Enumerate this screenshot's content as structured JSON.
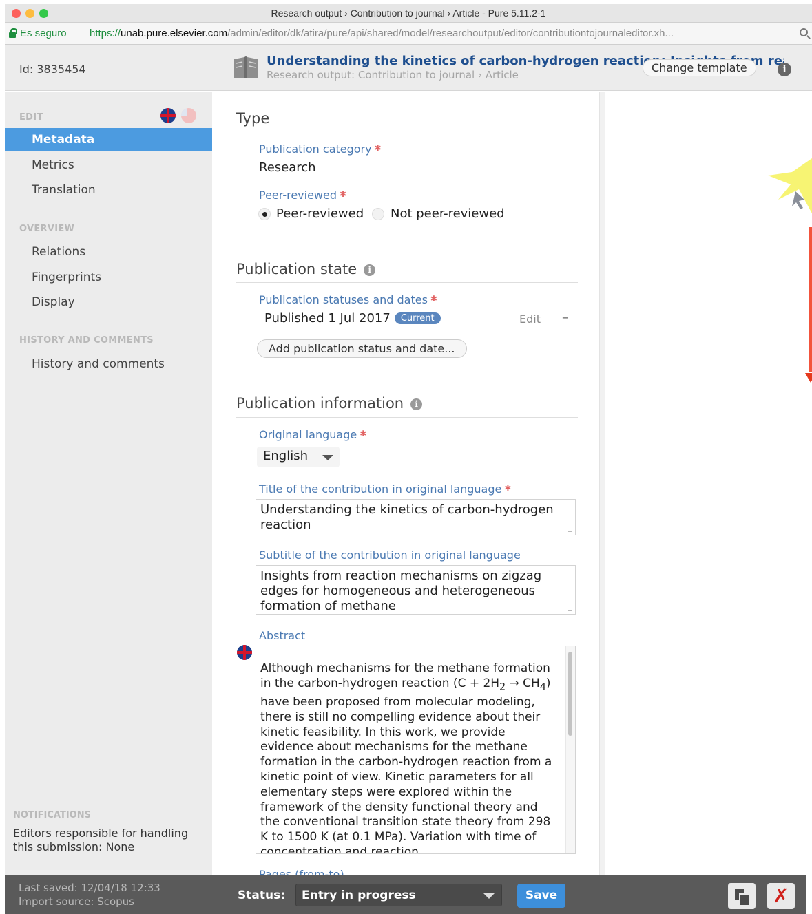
{
  "browser": {
    "window_title": "Research output › Contribution to journal › Article - Pure 5.11.2-1",
    "secure_label": "Es seguro",
    "url_scheme": "https://",
    "url_host": "unab.pure.elsevier.com",
    "url_path": "/admin/editor/dk/atira/pure/api/shared/model/researchoutput/editor/contributiontojournaleditor.xh..."
  },
  "header": {
    "id_label": "Id: 3835454",
    "title": "Understanding the kinetics of carbon-hydrogen reaction: Insights from reaction",
    "subtitle": "Research output: Contribution to journal › Article",
    "change_template": "Change template",
    "info_glyph": "i"
  },
  "sidebar": {
    "edit_heading": "EDIT",
    "edit_items": [
      "Metadata",
      "Metrics",
      "Translation"
    ],
    "overview_heading": "OVERVIEW",
    "overview_items": [
      "Relations",
      "Fingerprints",
      "Display"
    ],
    "history_heading": "HISTORY AND COMMENTS",
    "history_items": [
      "History and comments"
    ],
    "notifications_heading": "NOTIFICATIONS",
    "notifications_text": "Editors responsible for handling this submission: None"
  },
  "form": {
    "required_mark": "✱",
    "info_glyph": "i",
    "type_section": "Type",
    "publication_category_label": "Publication category",
    "publication_category_value": "Research",
    "peer_reviewed_label": "Peer-reviewed",
    "peer_reviewed_option": "Peer-reviewed",
    "not_peer_reviewed_option": "Not peer-reviewed",
    "state_section": "Publication state",
    "statuses_label": "Publication statuses and dates",
    "status_value": "Published 1 Jul 2017",
    "status_badge": "Current",
    "edit_link": "Edit",
    "remove_link": "–",
    "add_status_button": "Add publication status and date...",
    "info_section": "Publication information",
    "original_language_label": "Original language",
    "original_language_value": "English",
    "title_label": "Title of the contribution in original language",
    "title_value": "Understanding the kinetics of carbon-hydrogen reaction",
    "subtitle_label": "Subtitle of the contribution in original language",
    "subtitle_value": "Insights from reaction mechanisms on zigzag edges for homogeneous and heterogeneous formation of methane",
    "abstract_label": "Abstract",
    "abstract_line_1": "Although mechanisms for the methane formation in the carbon-hydrogen reaction (C + 2H",
    "abstract_h2_sub": "2",
    "abstract_arrow": " → CH",
    "abstract_ch4_sub": "4",
    "abstract_rest": ") have been proposed from molecular modeling, there is still no compelling evidence about their kinetic feasibility. In this work, we provide evidence about mechanisms for the methane formation in the carbon-hydrogen reaction from a kinetic point of view. Kinetic parameters for all elementary steps were explored within the framework of the density functional theory and the conventional transition state theory from 298 K to 1500 K (at 0.1 MPa). Variation with time of concentration and reaction",
    "next_label_partial": "Pages (from-to)"
  },
  "footer": {
    "last_saved": "Last saved: 12/04/18 12:33",
    "import_source": "Import source: Scopus",
    "status_label": "Status:",
    "status_value": "Entry in progress",
    "save_button": "Save",
    "delete_glyph": "✗"
  },
  "colors": {
    "accent_blue": "#4c9be0",
    "title_blue": "#1f4f8f",
    "label_blue": "#4a79b2",
    "footer_bg": "#5a5a5a",
    "delete_red": "#d0211b"
  }
}
